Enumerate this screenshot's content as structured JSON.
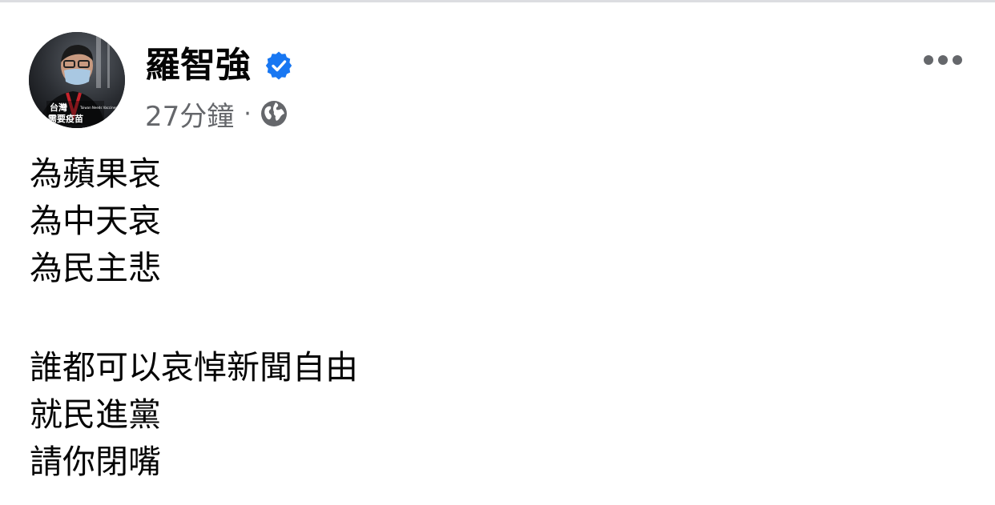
{
  "post": {
    "author": "羅智強",
    "verified": true,
    "timestamp": "27分鐘",
    "separator": "·",
    "privacy_icon": "globe-icon",
    "more_icon": "more-options-icon",
    "avatar_text": {
      "line1": "台灣",
      "line2": "需要疫苗",
      "side": "Taiwan Needs Vaccines"
    },
    "paragraphs": [
      [
        "為蘋果哀",
        "為中天哀",
        "為民主悲"
      ],
      [
        "誰都可以哀悼新聞自由",
        "就民進黨",
        "請你閉嘴"
      ]
    ]
  },
  "colors": {
    "verified_blue": "#1877f2",
    "meta_gray": "#65676b",
    "text": "#050505"
  }
}
